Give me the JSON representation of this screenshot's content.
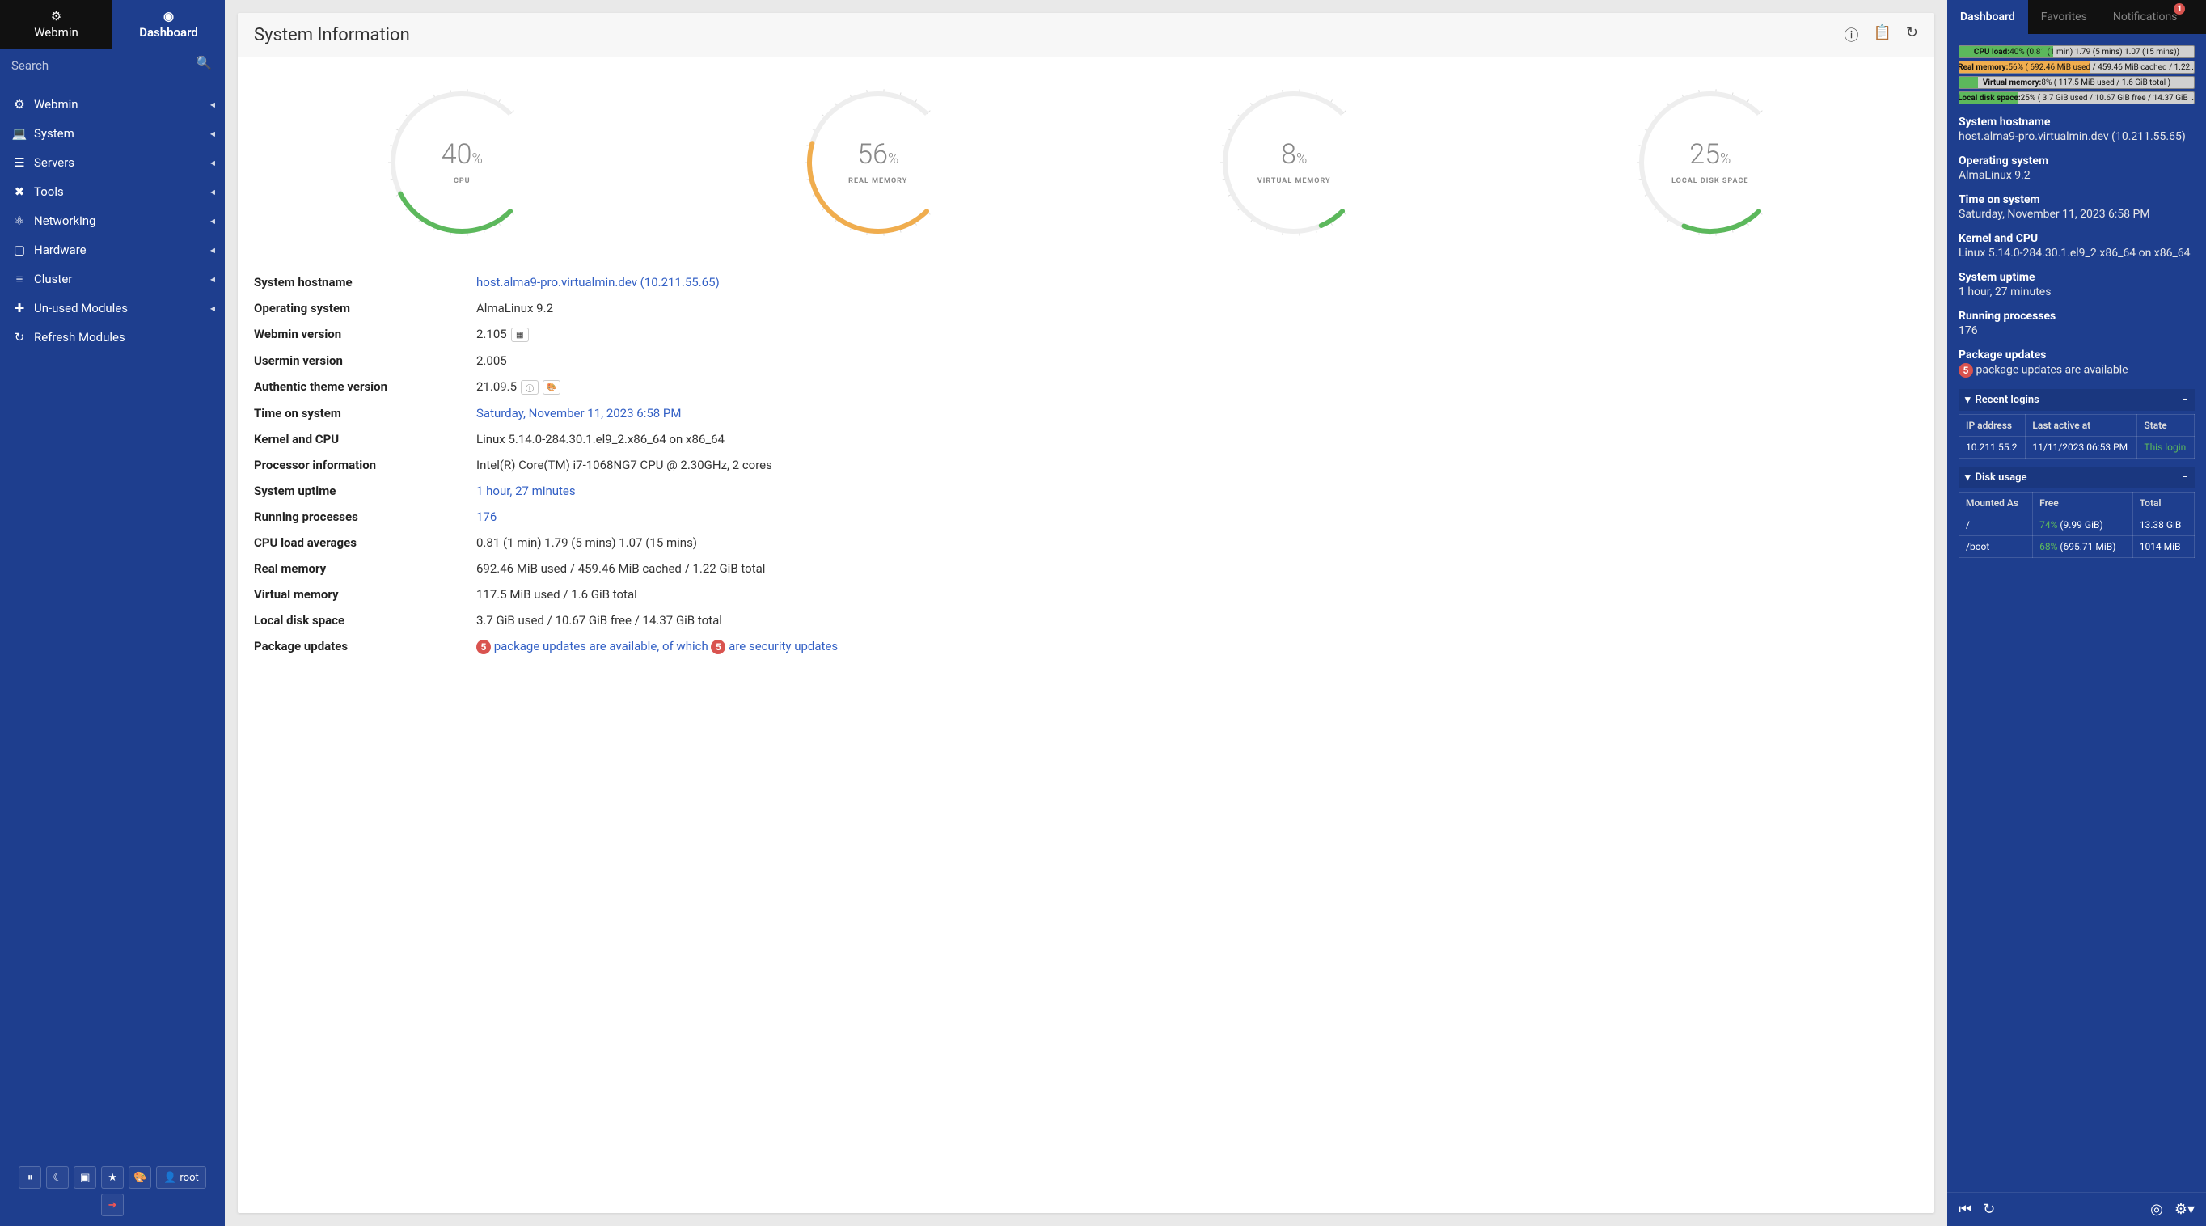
{
  "top_tabs": {
    "webmin": "Webmin",
    "dashboard": "Dashboard"
  },
  "search": {
    "placeholder": "Search"
  },
  "nav": [
    {
      "icon": "gear",
      "label": "Webmin",
      "expandable": true
    },
    {
      "icon": "laptop",
      "label": "System",
      "expandable": true
    },
    {
      "icon": "server",
      "label": "Servers",
      "expandable": true
    },
    {
      "icon": "tools",
      "label": "Tools",
      "expandable": true
    },
    {
      "icon": "network",
      "label": "Networking",
      "expandable": true
    },
    {
      "icon": "chip",
      "label": "Hardware",
      "expandable": true
    },
    {
      "icon": "layers",
      "label": "Cluster",
      "expandable": true
    },
    {
      "icon": "puzzle",
      "label": "Un-used Modules",
      "expandable": true
    },
    {
      "icon": "refresh",
      "label": "Refresh Modules",
      "expandable": false
    }
  ],
  "bottom_user": "root",
  "page_title": "System Information",
  "gauges": [
    {
      "value": 40,
      "label": "CPU",
      "color": "#5cb85c"
    },
    {
      "value": 56,
      "label": "REAL MEMORY",
      "color": "#f0ad4e"
    },
    {
      "value": 8,
      "label": "VIRTUAL MEMORY",
      "color": "#5cb85c"
    },
    {
      "value": 25,
      "label": "LOCAL DISK SPACE",
      "color": "#5cb85c"
    }
  ],
  "info_rows": {
    "hostname_l": "System hostname",
    "hostname_v": "host.alma9-pro.virtualmin.dev (10.211.55.65)",
    "os_l": "Operating system",
    "os_v": "AlmaLinux 9.2",
    "webmin_l": "Webmin version",
    "webmin_v": "2.105",
    "usermin_l": "Usermin version",
    "usermin_v": "2.005",
    "theme_l": "Authentic theme version",
    "theme_v": "21.09.5",
    "time_l": "Time on system",
    "time_v": "Saturday, November 11, 2023 6:58 PM",
    "kernel_l": "Kernel and CPU",
    "kernel_v": "Linux 5.14.0-284.30.1.el9_2.x86_64 on x86_64",
    "proc_l": "Processor information",
    "proc_v": "Intel(R) Core(TM) i7-1068NG7 CPU @ 2.30GHz, 2 cores",
    "uptime_l": "System uptime",
    "uptime_v": "1 hour, 27 minutes",
    "procs_l": "Running processes",
    "procs_v": "176",
    "load_l": "CPU load averages",
    "load_v": "0.81 (1 min) 1.79 (5 mins) 1.07 (15 mins)",
    "realmem_l": "Real memory",
    "realmem_v": "692.46 MiB used / 459.46 MiB cached / 1.22 GiB total",
    "virtmem_l": "Virtual memory",
    "virtmem_v": "117.5 MiB used / 1.6 GiB total",
    "disk_l": "Local disk space",
    "disk_v": "3.7 GiB used / 10.67 GiB free / 14.37 GiB total",
    "pkg_l": "Package updates",
    "pkg_count": "5",
    "pkg_text1": " package updates are available, of which ",
    "pkg_sec_count": "5",
    "pkg_text2": " are security updates"
  },
  "right_tabs": {
    "dashboard": "Dashboard",
    "favorites": "Favorites",
    "notifications": "Notifications",
    "notif_count": "1"
  },
  "mini_bars": [
    {
      "label": "CPU load:",
      "text": "40% (0.81 (1 min) 1.79 (5 mins) 1.07 (15 mins))",
      "pct": 40,
      "color": "#5cb85c"
    },
    {
      "label": "Real memory:",
      "text": "56% ( 692.46 MiB used / 459.46 MiB cached / 1.22…",
      "pct": 56,
      "color": "#f0ad4e"
    },
    {
      "label": "Virtual memory:",
      "text": "8% ( 117.5 MiB used / 1.6 GiB total )",
      "pct": 8,
      "color": "#5cb85c"
    },
    {
      "label": "Local disk space:",
      "text": "25% ( 3.7 GiB used / 10.67 GiB free / 14.37 GiB …",
      "pct": 25,
      "color": "#5cb85c"
    }
  ],
  "rp": {
    "hostname_h": "System hostname",
    "hostname_v": "host.alma9-pro.virtualmin.dev (10.211.55.65)",
    "os_h": "Operating system",
    "os_v": "AlmaLinux 9.2",
    "time_h": "Time on system",
    "time_v": "Saturday, November 11, 2023 6:58 PM",
    "kernel_h": "Kernel and CPU",
    "kernel_v": "Linux 5.14.0-284.30.1.el9_2.x86_64 on x86_64",
    "uptime_h": "System uptime",
    "uptime_v": "1 hour, 27 minutes",
    "procs_h": "Running processes",
    "procs_v": "176",
    "pkg_h": "Package updates",
    "pkg_count": "5",
    "pkg_v": "package updates are available",
    "logins_h": "Recent logins",
    "logins_th1": "IP address",
    "logins_th2": "Last active at",
    "logins_th3": "State",
    "logins_r1_ip": "10.211.55.2",
    "logins_r1_time": "11/11/2023 06:53 PM",
    "logins_r1_state": "This login",
    "disk_h": "Disk usage",
    "disk_th1": "Mounted As",
    "disk_th2": "Free",
    "disk_th3": "Total",
    "disk_r1_m": "/",
    "disk_r1_pct": "74%",
    "disk_r1_free": " (9.99 GiB)",
    "disk_r1_total": "13.38 GiB",
    "disk_r2_m": "/boot",
    "disk_r2_pct": "68%",
    "disk_r2_free": " (695.71 MiB)",
    "disk_r2_total": "1014 MiB"
  }
}
